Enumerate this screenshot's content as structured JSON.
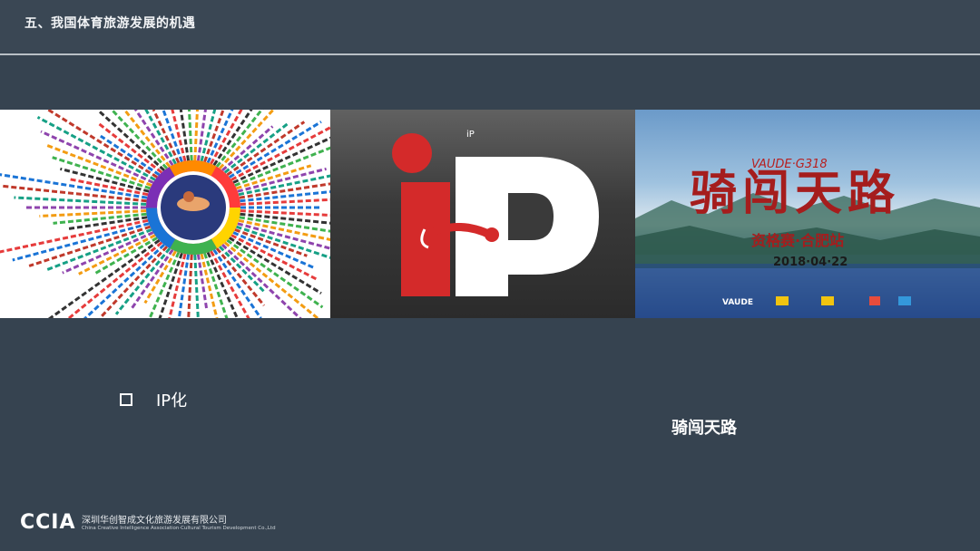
{
  "slide": {
    "title": "五、我国体育旅游发展的机遇",
    "bullet_text": "IP化",
    "caption": "骑闯天路"
  },
  "poster": {
    "brand": "VAUDE·G318",
    "headline": "骑闯天路",
    "sub_headline": "资格赛·合肥站",
    "date": "2018·04·22",
    "sponsor": "VAUDE"
  },
  "ip_graphic": {
    "letters": "iP"
  },
  "footer": {
    "logo": "CCIA",
    "company_cn": "深圳华创智成文化旅游发展有限公司",
    "company_en": "China Creative Intelligence Association·Cultural Tourism Development Co.,Ltd"
  },
  "colors": {
    "background": "#364350",
    "rule": "#b9c0c6",
    "ip_red": "#d42a2a",
    "poster_red": "#a51d1d"
  }
}
